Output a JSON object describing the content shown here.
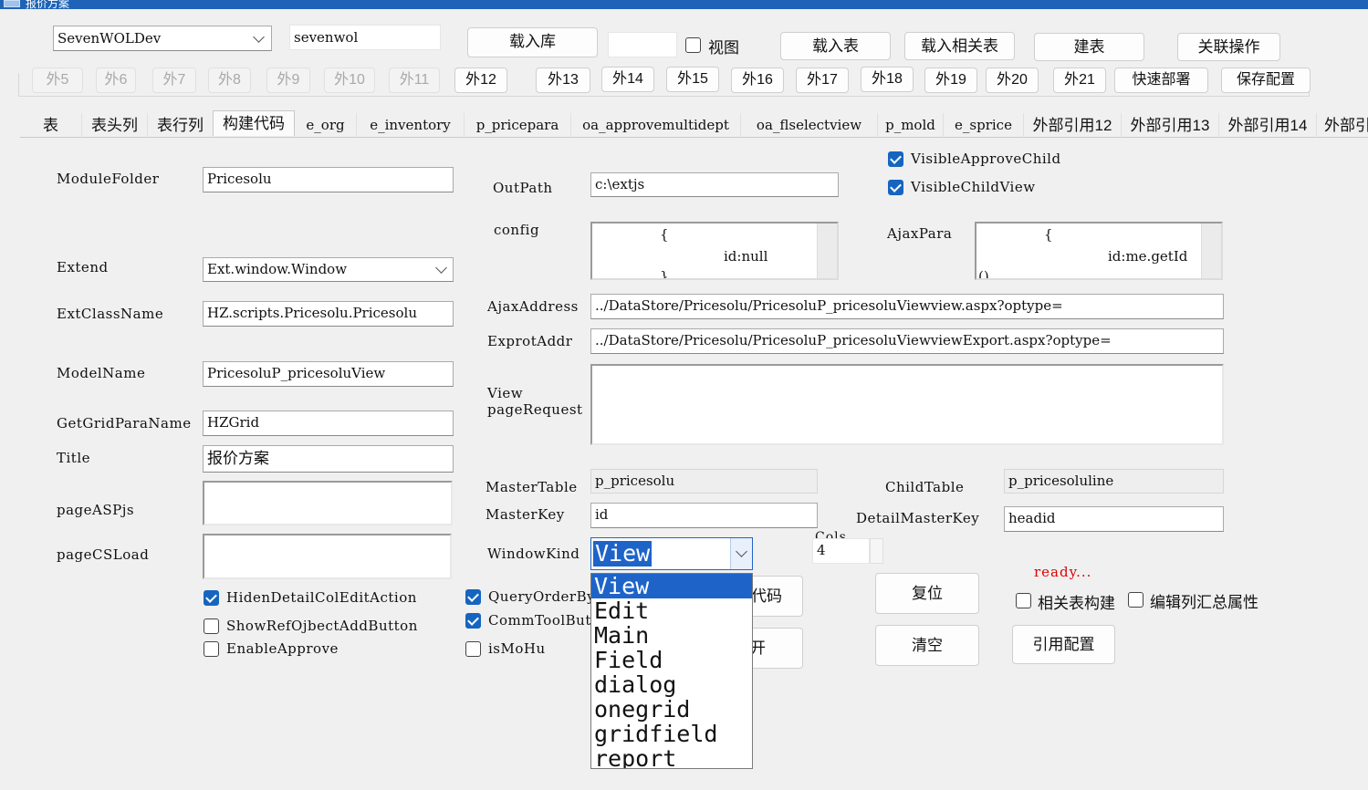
{
  "window": {
    "title": "报价方案"
  },
  "top": {
    "db_select": "SevenWOLDev",
    "user_input": "sevenwol",
    "load_db_button": "载入库",
    "view_input": "",
    "view_checkbox_label": "视图",
    "load_table_button": "载入表",
    "load_related_button": "载入相关表",
    "build_table_button": "建表",
    "relate_ops_button": "关联操作"
  },
  "ext_buttons": {
    "disabled": [
      "外5",
      "外6",
      "外7",
      "外8",
      "外9",
      "外10",
      "外11"
    ],
    "enabled": [
      "外12",
      "外13",
      "外14",
      "外15",
      "外16",
      "外17",
      "外18",
      "外19",
      "外20",
      "外21"
    ],
    "quick_deploy": "快速部署",
    "save_config": "保存配置"
  },
  "tabs": [
    "表",
    "表头列",
    "表行列",
    "构建代码",
    "e_org",
    "e_inventory",
    "p_pricepara",
    "oa_approvemultidept",
    "oa_flselectview",
    "p_mold",
    "e_sprice",
    "外部引用12",
    "外部引用13",
    "外部引用14",
    "外部引"
  ],
  "form": {
    "module_folder_label": "ModuleFolder",
    "module_folder": "Pricesolu",
    "extend_label": "Extend",
    "extend": "Ext.window.Window",
    "ext_class_name_label": "ExtClassName",
    "ext_class_name": "HZ.scripts.Pricesolu.Pricesolu",
    "model_name_label": "ModelName",
    "model_name": "PricesoluP_pricesoluView",
    "get_grid_para_name_label": "GetGridParaName",
    "get_grid_para_name": "HZGrid",
    "title_label": "Title",
    "title": "报价方案",
    "page_asp_js_label": "pageASPjs",
    "page_cs_load_label": "pageCSLoad",
    "out_path_label": "OutPath",
    "out_path": "c:\\extjs",
    "config_label": "config",
    "config_line1": "{",
    "config_line2": "id:null",
    "config_line3": "}",
    "ajax_para_label": "AjaxPara",
    "ajax_para_line1": "{",
    "ajax_para_line2": "id:me.getId",
    "ajax_para_line3": "()",
    "ajax_address_label": "AjaxAddress",
    "ajax_address": "../DataStore/Pricesolu/PricesoluP_pricesoluViewview.aspx?optype=",
    "export_addr_label": "ExprotAddr",
    "export_addr": "../DataStore/Pricesolu/PricesoluP_pricesoluViewviewExport.aspx?optype=",
    "view_page_request_label_1": "View",
    "view_page_request_label_2": "pageRequest",
    "master_table_label": "MasterTable",
    "master_table": "p_pricesolu",
    "child_table_label": "ChildTable",
    "child_table": "p_pricesoluline",
    "master_key_label": "MasterKey",
    "master_key": "id",
    "detail_master_key_label": "DetailMasterKey",
    "detail_master_key": "headid",
    "window_kind_label": "WindowKind",
    "window_kind": "View",
    "cols_label": "Cols",
    "cols": "4",
    "status": "ready..."
  },
  "checkboxes": {
    "visible_approve_child": "VisibleApproveChild",
    "visible_child_view": "VisibleChildView",
    "hiden_detail_col_edit_action": "HidenDetailColEditAction",
    "show_ref_object_add_button": "ShowRefOjbectAddButton",
    "enable_approve": "EnableApprove",
    "query_order_by": "QueryOrderBy",
    "comm_tool_button": "CommToolButt",
    "is_mo_hu": "isMoHu",
    "related_build": "相关表构建",
    "edit_col_summary": "编辑列汇总属性"
  },
  "actions": {
    "gen_code_partial": "代码",
    "open_partial": "开",
    "reset": "复位",
    "clear": "清空",
    "ref_config": "引用配置"
  },
  "window_kind_options": [
    "View",
    "Edit",
    "Main",
    "Field",
    "dialog",
    "onegrid",
    "gridfield",
    "report"
  ],
  "colors": {
    "accent": "#1565c0",
    "status": "#e00000",
    "selection": "#1e64c8"
  }
}
